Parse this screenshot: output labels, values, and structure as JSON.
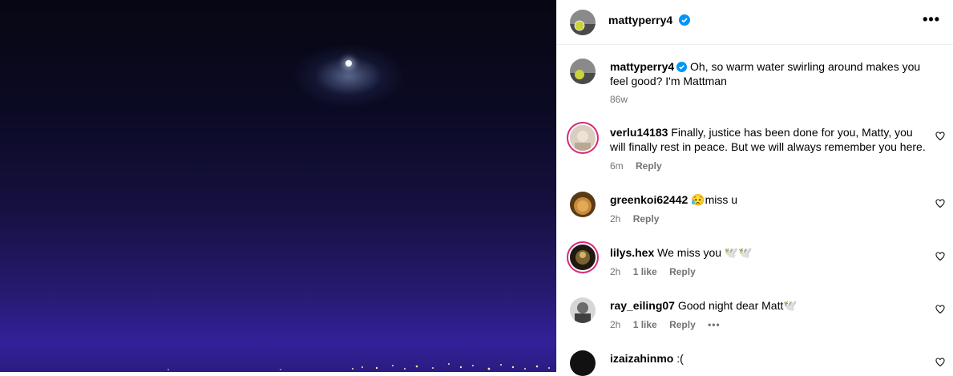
{
  "post": {
    "author": "mattyperry4",
    "caption": "Oh, so warm water swirling around makes you feel good? I'm Mattman",
    "caption_time": "86w"
  },
  "comments": [
    {
      "user": "verlu14183",
      "text": "Finally, justice has been done for you, Matty, you will finally rest in peace. But we will always remember you here.",
      "time": "6m",
      "likes": "",
      "reply": "Reply"
    },
    {
      "user": "greenkoi62442",
      "text": "😥miss u",
      "time": "2h",
      "likes": "",
      "reply": "Reply"
    },
    {
      "user": "lilys.hex",
      "text": "We miss you 🕊️🕊️",
      "time": "2h",
      "likes": "1 like",
      "reply": "Reply"
    },
    {
      "user": "ray_eiling07",
      "text": "Good night dear Matt🕊️",
      "time": "2h",
      "likes": "1 like",
      "reply": "Reply"
    },
    {
      "user": "izaizahinmo",
      "text": ":(",
      "time": "",
      "likes": "",
      "reply": ""
    }
  ],
  "colors": {
    "verified": "#0095f6",
    "meta": "#737373",
    "story_ring": "#d62976"
  },
  "icons": [
    "verified-badge-icon",
    "more-options-icon",
    "heart-icon"
  ]
}
